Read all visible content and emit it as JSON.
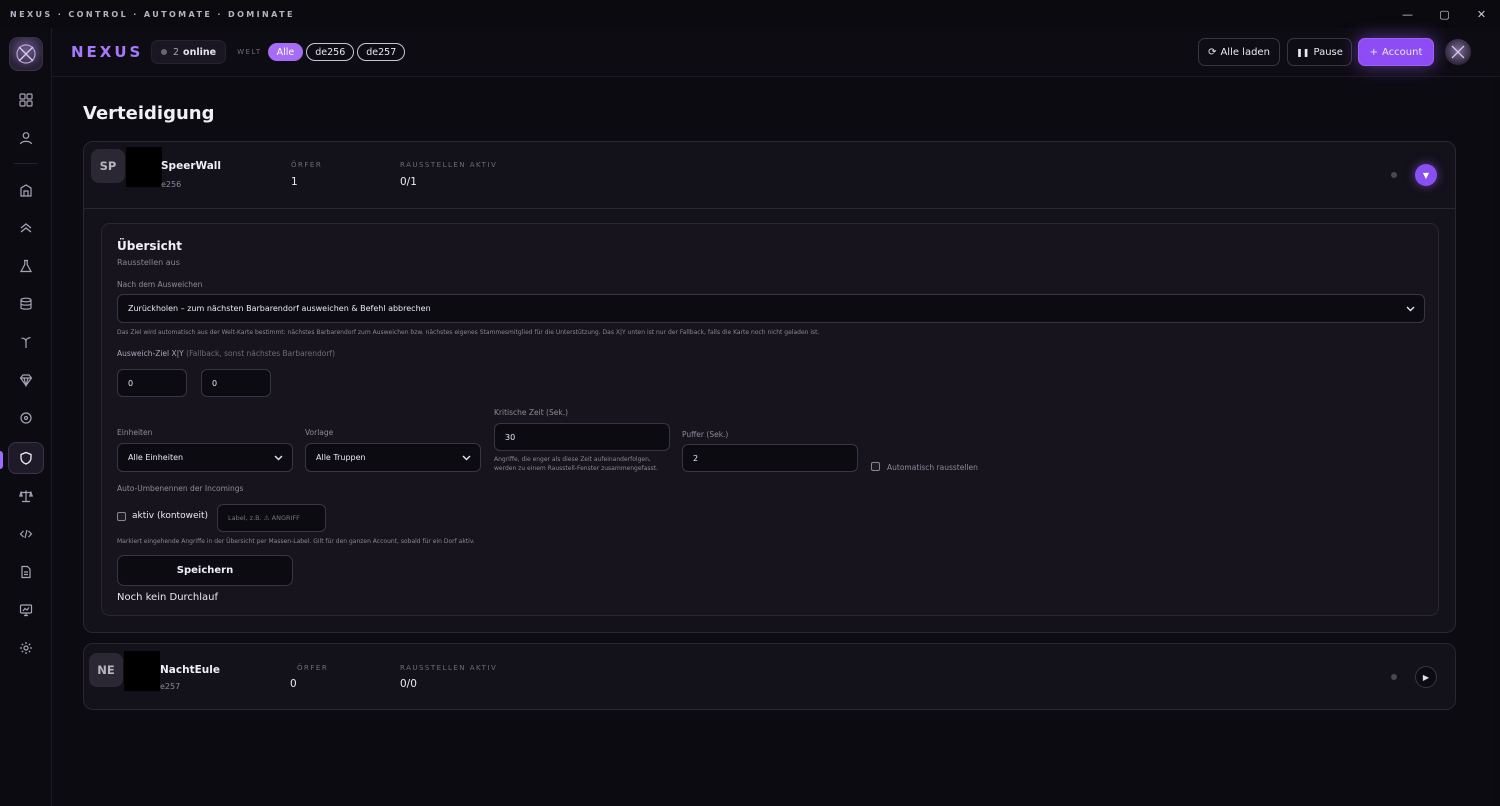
{
  "titlebar": {
    "title": "NEXUS · CONTROL · AUTOMATE · DOMINATE",
    "minimize": "—",
    "maximize": "▢",
    "close": "✕"
  },
  "topbar": {
    "brand": "NEXUS",
    "online_count": "2",
    "online_label": "online",
    "welt_label": "WELT",
    "worlds": [
      "Alle",
      "de256",
      "de257"
    ],
    "load_all": "Alle laden",
    "pause": "Pause",
    "add_account": "Account"
  },
  "page": {
    "title": "Verteidigung"
  },
  "accounts": [
    {
      "initials": "SP",
      "name": "SpeerWall",
      "world": "e256",
      "stat1_label": "ÖRFER",
      "stat1_value": "1",
      "stat2_label": "RAUSSTELLEN AKTIV",
      "stat2_value": "0/1"
    },
    {
      "initials": "NE",
      "name": "NachtEule",
      "world": "e257",
      "stat1_label": "ÖRFER",
      "stat1_value": "0",
      "stat2_label": "RAUSSTELLEN AKTIV",
      "stat2_value": "0/0"
    }
  ],
  "overview": {
    "title": "Übersicht",
    "subtitle": "Rausstellen aus",
    "after_evade_label": "Nach dem Ausweichen",
    "after_evade_value": "Zurückholen – zum nächsten Barbarendorf ausweichen & Befehl abbrechen",
    "after_evade_hint": "Das Ziel wird automatisch aus der Welt-Karte bestimmt: nächstes Barbarendorf zum Ausweichen bzw. nächstes eigenes Stammesmitglied für die Unterstützung. Das X|Y unten ist nur der Fallback, falls die Karte noch nicht geladen ist.",
    "target_label": "Ausweich-Ziel X|Y",
    "target_hint": "(Fallback, sonst nächstes Barbarendorf)",
    "target_x": "0",
    "target_y": "0",
    "units_label": "Einheiten",
    "units_value": "Alle Einheiten",
    "template_label": "Vorlage",
    "template_value": "Alle Truppen",
    "critical_label": "Kritische Zeit (Sek.)",
    "critical_value": "30",
    "critical_hint_1": "Angriffe, die enger als diese Zeit aufeinanderfolgen,",
    "critical_hint_2": "werden zu einem Rausstell-Fenster zusammengefasst.",
    "buffer_label": "Puffer (Sek.)",
    "buffer_value": "2",
    "auto_label": "Automatisch rausstellen",
    "rename_label": "Auto-Umbenennen der Incomings",
    "rename_active_label": "aktiv (kontoweit)",
    "rename_placeholder": "Label, z.B. ⚠ ANGRIFF",
    "rename_hint": "Markiert eingehende Angriffe in der Übersicht per Massen-Label. Gilt für den ganzen Account, sobald für ein Dorf aktiv.",
    "save": "Speichern",
    "no_run": "Noch kein Durchlauf"
  }
}
